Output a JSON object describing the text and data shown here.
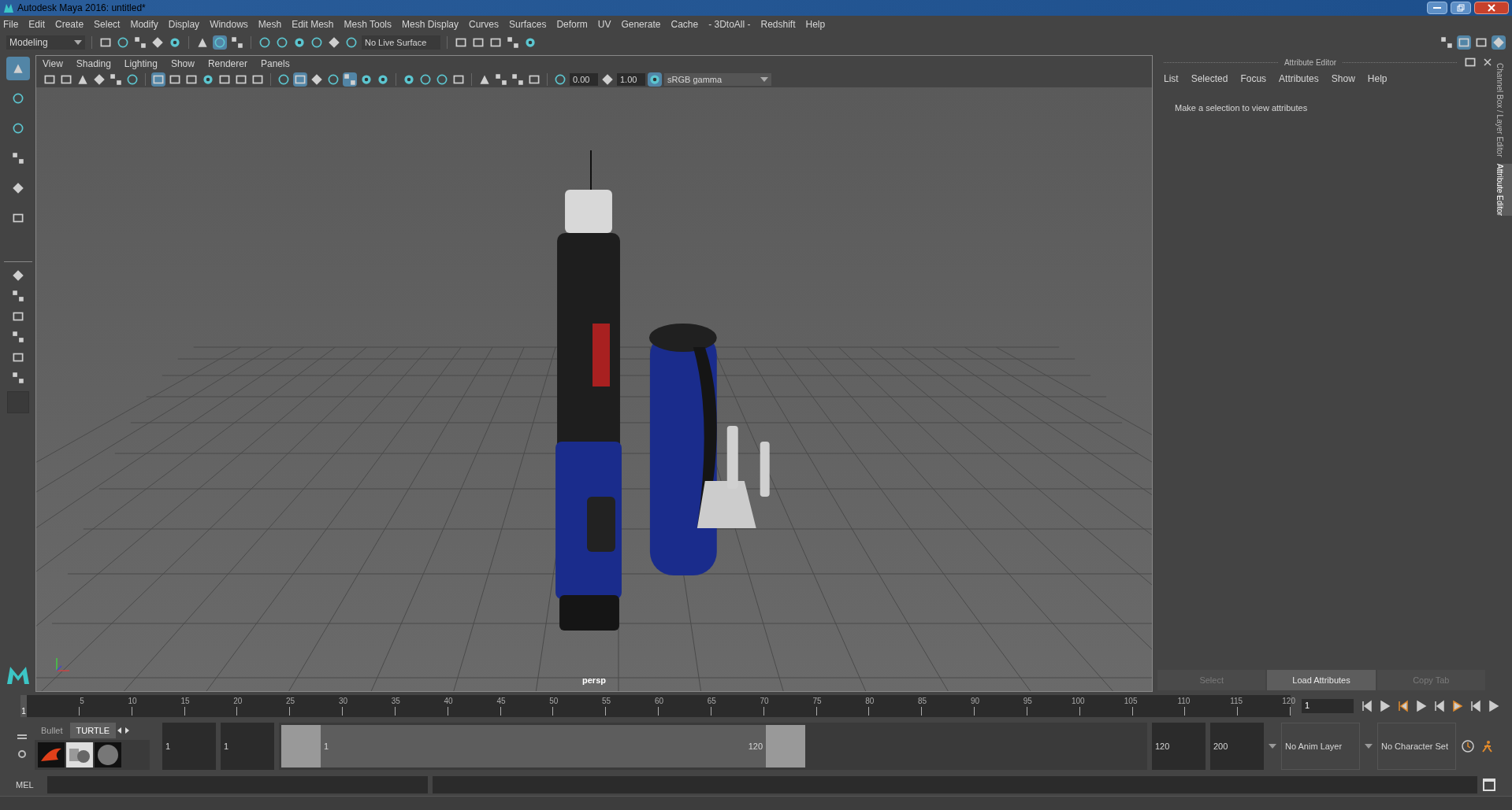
{
  "window": {
    "title": "Autodesk Maya 2016: untitled*"
  },
  "menu": [
    "File",
    "Edit",
    "Create",
    "Select",
    "Modify",
    "Display",
    "Windows",
    "Mesh",
    "Edit Mesh",
    "Mesh Tools",
    "Mesh Display",
    "Curves",
    "Surfaces",
    "Deform",
    "UV",
    "Generate",
    "Cache",
    "- 3DtoAll -",
    "Redshift",
    "Help"
  ],
  "shelf": {
    "mode": "Modeling",
    "live_surface": "No Live Surface"
  },
  "viewport": {
    "menu": [
      "View",
      "Shading",
      "Lighting",
      "Show",
      "Renderer",
      "Panels"
    ],
    "exposure": "0.00",
    "gamma": "1.00",
    "color_space": "sRGB gamma",
    "camera": "persp"
  },
  "attribute_editor": {
    "title": "Attribute Editor",
    "menu": [
      "List",
      "Selected",
      "Focus",
      "Attributes",
      "Show",
      "Help"
    ],
    "message": "Make a selection to view attributes",
    "buttons": [
      {
        "label": "Select",
        "disabled": true
      },
      {
        "label": "Load Attributes",
        "disabled": false
      },
      {
        "label": "Copy Tab",
        "disabled": true
      }
    ]
  },
  "side_tabs": [
    {
      "label": "Channel Box / Layer Editor",
      "selected": false
    },
    {
      "label": "Attribute Editor",
      "selected": true
    }
  ],
  "timeline": {
    "start_label": "1",
    "ticks": [
      "5",
      "10",
      "15",
      "20",
      "25",
      "30",
      "35",
      "40",
      "45",
      "50",
      "55",
      "60",
      "65",
      "70",
      "75",
      "80",
      "85",
      "90",
      "95",
      "100",
      "105",
      "110",
      "115",
      "120"
    ],
    "frame_field": "1"
  },
  "shelf_tabs": [
    {
      "label": "Bullet",
      "selected": false
    },
    {
      "label": "TURTLE",
      "selected": true
    }
  ],
  "range": {
    "start": "1",
    "inner_start": "1",
    "slider_start": "1",
    "slider_end": "120",
    "inner_end": "120",
    "end": "200",
    "anim_layer": "No Anim Layer",
    "character_set": "No Character Set"
  },
  "command_line": {
    "label": "MEL"
  }
}
